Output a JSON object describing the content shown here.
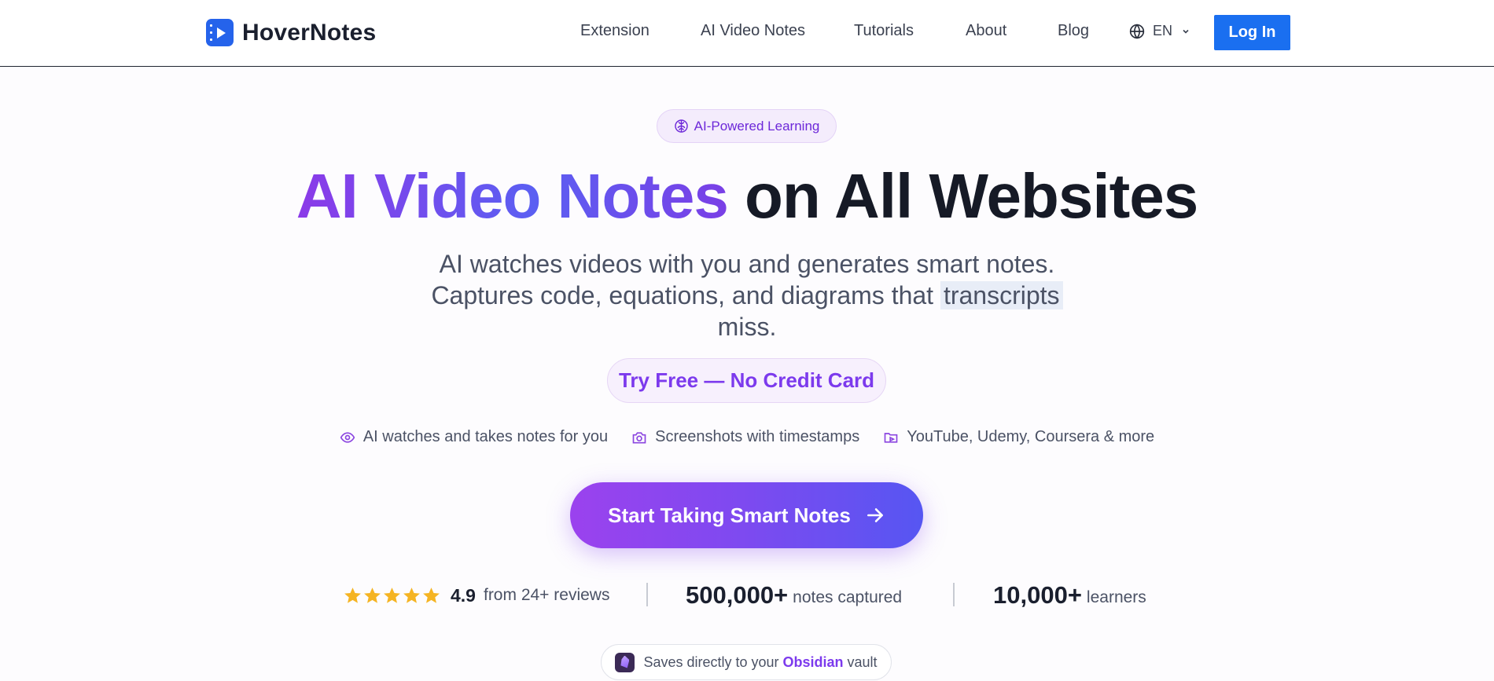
{
  "header": {
    "brand": "HoverNotes",
    "nav": [
      "Extension",
      "AI Video Notes",
      "Tutorials",
      "About",
      "Blog"
    ],
    "language": "EN",
    "login_label": "Log In"
  },
  "hero": {
    "badge": "AI-Powered Learning",
    "headline_highlight": "AI Video Notes",
    "headline_rest": "on All Websites",
    "subtitle_line1": "AI watches videos with you and generates smart notes.",
    "subtitle_line2_pre": "Captures code, equations, and diagrams that",
    "subtitle_line2_highlight": "transcripts",
    "subtitle_line3": "miss.",
    "try_label": "Try Free — No Credit Card",
    "features": [
      "AI watches and takes notes for you",
      "Screenshots with timestamps",
      "YouTube, Udemy, Coursera & more"
    ],
    "cta_label": "Start Taking Smart Notes"
  },
  "stats": {
    "stars": 5,
    "rating": "4.9",
    "reviews_text": "from 24+ reviews",
    "notes_value": "500,000+",
    "notes_label": "notes captured",
    "learners_value": "10,000+",
    "learners_label": "learners"
  },
  "obsidian": {
    "pre": "Saves directly to your",
    "highlight": "Obsidian",
    "post": "vault"
  },
  "colors": {
    "brand_blue": "#1a6ff0",
    "purple": "#7c3aed",
    "star": "#f5b423"
  }
}
